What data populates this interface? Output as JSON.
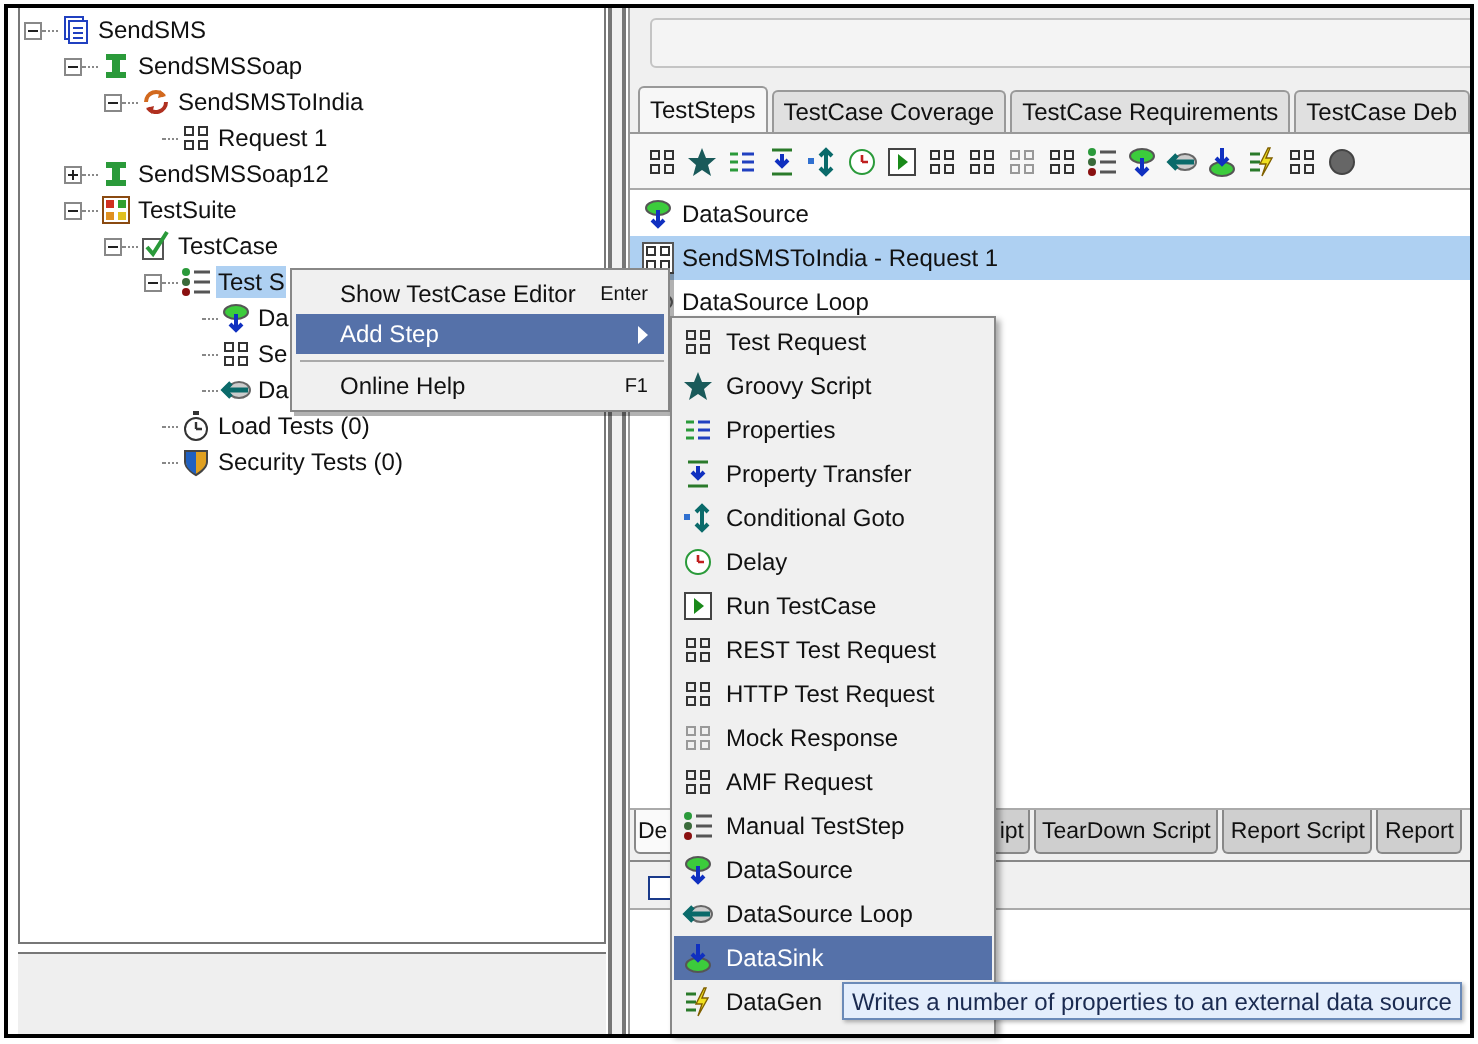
{
  "tree": [
    {
      "label": "SendSMS",
      "kind": "project",
      "expanded": true,
      "selected": false,
      "children": [
        {
          "label": "SendSMSSoap",
          "kind": "interface",
          "expanded": true,
          "selected": false,
          "children": [
            {
              "label": "SendSMSToIndia",
              "kind": "operation",
              "expanded": true,
              "selected": false,
              "children": [
                {
                  "label": "Request 1",
                  "kind": "request",
                  "selected": false
                }
              ]
            }
          ]
        },
        {
          "label": "SendSMSSoap12",
          "kind": "interface",
          "expanded": false,
          "selected": false
        },
        {
          "label": "TestSuite",
          "kind": "testsuite",
          "expanded": true,
          "selected": false,
          "children": [
            {
              "label": "TestCase",
              "kind": "testcase",
              "expanded": true,
              "selected": false,
              "children": [
                {
                  "label": "Test S",
                  "kind": "teststeps",
                  "expanded": true,
                  "selected": true,
                  "children": [
                    {
                      "label": "Da",
                      "kind": "datasource",
                      "selected": false
                    },
                    {
                      "label": "Se",
                      "kind": "request",
                      "selected": false
                    },
                    {
                      "label": "Da",
                      "kind": "datasource-loop",
                      "selected": false
                    }
                  ]
                },
                {
                  "label": "Load Tests (0)",
                  "kind": "load-tests",
                  "selected": false
                },
                {
                  "label": "Security Tests (0)",
                  "kind": "security-tests",
                  "selected": false
                }
              ]
            }
          ]
        }
      ]
    }
  ],
  "tabs": [
    {
      "label": "TestSteps",
      "selected": true
    },
    {
      "label": "TestCase Coverage",
      "selected": false
    },
    {
      "label": "TestCase Requirements",
      "selected": false
    },
    {
      "label": "TestCase Deb",
      "selected": false
    }
  ],
  "steps": [
    {
      "label": "DataSource",
      "kind": "datasource",
      "selected": false
    },
    {
      "label": "SendSMSToIndia - Request 1",
      "kind": "request",
      "selected": true
    },
    {
      "label": "DataSource Loop",
      "kind": "datasource-loop",
      "selected": false
    }
  ],
  "bottom_tabs": [
    {
      "label": "De",
      "selected": true
    },
    {
      "label": "ipt",
      "selected": false
    },
    {
      "label": "TearDown Script",
      "selected": false
    },
    {
      "label": "Report Script",
      "selected": false
    },
    {
      "label": "Report",
      "selected": false
    }
  ],
  "log_checkbox": {
    "checked": false
  },
  "context_menu": [
    {
      "kind": "item",
      "label": "Show TestCase Editor",
      "shortcut": "Enter",
      "selected": false
    },
    {
      "kind": "submenu",
      "label": "Add Step",
      "selected": true
    },
    {
      "kind": "separator"
    },
    {
      "kind": "item",
      "label": "Online Help",
      "shortcut": "F1",
      "selected": false
    }
  ],
  "submenu": [
    {
      "label": "Test Request",
      "kind": "request",
      "selected": false
    },
    {
      "label": "Groovy Script",
      "kind": "groovy",
      "selected": false
    },
    {
      "label": "Properties",
      "kind": "properties",
      "selected": false
    },
    {
      "label": "Property Transfer",
      "kind": "property-transfer",
      "selected": false
    },
    {
      "label": "Conditional Goto",
      "kind": "goto",
      "selected": false
    },
    {
      "label": "Delay",
      "kind": "delay",
      "selected": false
    },
    {
      "label": "Run TestCase",
      "kind": "run-testcase",
      "selected": false
    },
    {
      "label": "REST Test Request",
      "kind": "rest",
      "selected": false
    },
    {
      "label": "HTTP Test Request",
      "kind": "http",
      "selected": false
    },
    {
      "label": "Mock Response",
      "kind": "mock",
      "selected": false
    },
    {
      "label": "AMF Request",
      "kind": "amf",
      "selected": false
    },
    {
      "label": "Manual TestStep",
      "kind": "manual",
      "selected": false
    },
    {
      "label": "DataSource",
      "kind": "datasource",
      "selected": false
    },
    {
      "label": "DataSource Loop",
      "kind": "datasource-loop",
      "selected": false
    },
    {
      "label": "DataSink",
      "kind": "datasink",
      "selected": true
    },
    {
      "label": "DataGen",
      "kind": "datagen",
      "selected": false
    }
  ],
  "tooltip": "Writes a number of properties to an external data source"
}
